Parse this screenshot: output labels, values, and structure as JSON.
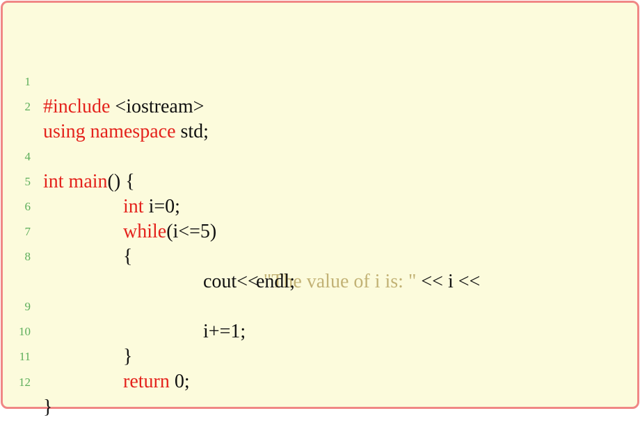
{
  "colors": {
    "background": "#fcfbdc",
    "border": "#f08785",
    "keyword": "#e4221c",
    "string": "#c2b275",
    "line_number": "#5cae5a",
    "text": "#111111"
  },
  "lines": [
    {
      "number": "1",
      "tokens": [
        {
          "text": "#include",
          "type": "keyword"
        },
        {
          "text": " <iostream>",
          "type": "text"
        }
      ]
    },
    {
      "number": "2",
      "tokens": [
        {
          "text": "using namespace",
          "type": "keyword"
        },
        {
          "text": " std;",
          "type": "text"
        }
      ]
    },
    {
      "number": "4",
      "tokens": [
        {
          "text": "int main",
          "type": "keyword"
        },
        {
          "text": "() {",
          "type": "text"
        }
      ]
    },
    {
      "number": "5",
      "tokens": [
        {
          "text": "int",
          "type": "keyword"
        },
        {
          "text": " i=0;",
          "type": "text"
        }
      ]
    },
    {
      "number": "6",
      "tokens": [
        {
          "text": "while",
          "type": "keyword"
        },
        {
          "text": "(i<=5)",
          "type": "text"
        }
      ]
    },
    {
      "number": "7",
      "tokens": [
        {
          "text": "{",
          "type": "text"
        }
      ]
    },
    {
      "number": "8",
      "tokens": [
        {
          "text": "cout<< ",
          "type": "text"
        },
        {
          "text": "\"The value of i is: \"",
          "type": "string"
        },
        {
          "text": " << i <<",
          "type": "text"
        }
      ]
    },
    {
      "number": "",
      "tokens": [
        {
          "text": "endl;",
          "type": "text"
        }
      ]
    },
    {
      "number": "9",
      "tokens": [
        {
          "text": "i+=1;",
          "type": "text"
        }
      ]
    },
    {
      "number": "10",
      "tokens": [
        {
          "text": "}",
          "type": "text"
        }
      ]
    },
    {
      "number": "11",
      "tokens": [
        {
          "text": "return",
          "type": "keyword"
        },
        {
          "text": " 0;",
          "type": "text"
        }
      ]
    },
    {
      "number": "12",
      "tokens": [
        {
          "text": "}",
          "type": "text"
        }
      ]
    }
  ]
}
